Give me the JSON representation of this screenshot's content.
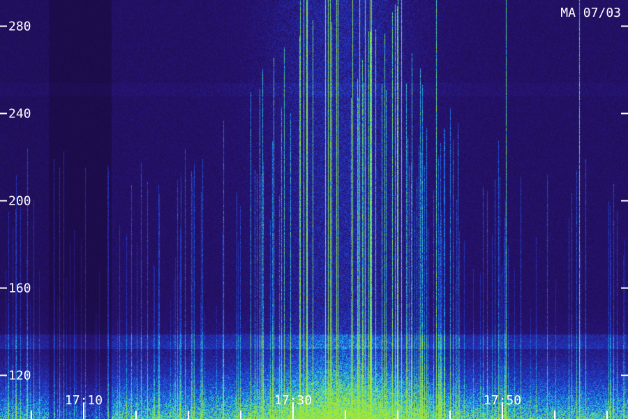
{
  "label": "MA 07/03",
  "colors": {
    "background": "#1e0f4a",
    "low": "#2a1670",
    "mid": "#1f4ed8",
    "high": "#22d3ee",
    "peak": "#a3e635",
    "text": "#ffffff"
  },
  "chart_data": {
    "type": "heatmap",
    "x": {
      "tick_labels": [
        "17:10",
        "17:30",
        "17:50"
      ],
      "tick_minutes": [
        10,
        30,
        50
      ],
      "range_minutes": [
        2,
        62
      ],
      "minor_step_minutes": 5
    },
    "y": {
      "tick_labels": [
        "120",
        "160",
        "200",
        "240",
        "280"
      ],
      "tick_values": [
        120,
        160,
        200,
        240,
        280
      ],
      "range": [
        100,
        292
      ]
    },
    "grid": false,
    "legend": "none"
  }
}
